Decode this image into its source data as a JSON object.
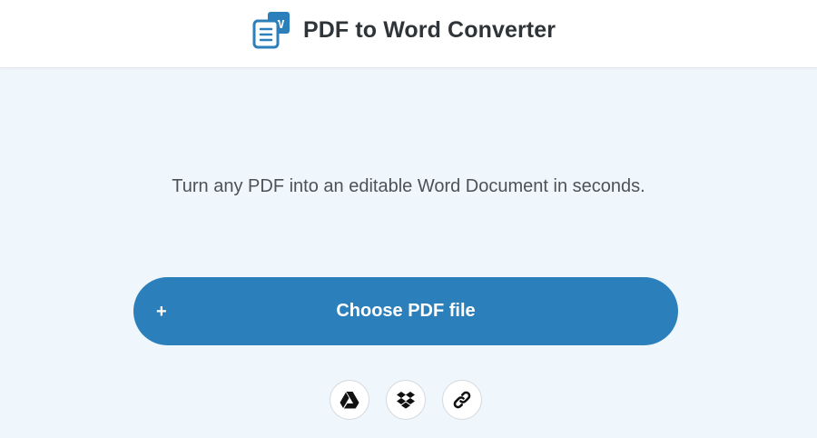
{
  "header": {
    "title": "PDF to Word Converter",
    "logo_icon": "word-document-icon",
    "logo_badge": "W"
  },
  "main": {
    "tagline": "Turn any PDF into an editable Word Document in seconds.",
    "choose_button": {
      "icon": "+",
      "label": "Choose PDF file"
    },
    "sources": [
      {
        "name": "google-drive",
        "icon": "google-drive-icon"
      },
      {
        "name": "dropbox",
        "icon": "dropbox-icon"
      },
      {
        "name": "url-link",
        "icon": "link-icon"
      }
    ]
  },
  "colors": {
    "accent": "#2b7fba",
    "page_background": "#eff6fc",
    "header_background": "#ffffff",
    "title_text": "#2f3438",
    "body_text": "#4d5257"
  }
}
